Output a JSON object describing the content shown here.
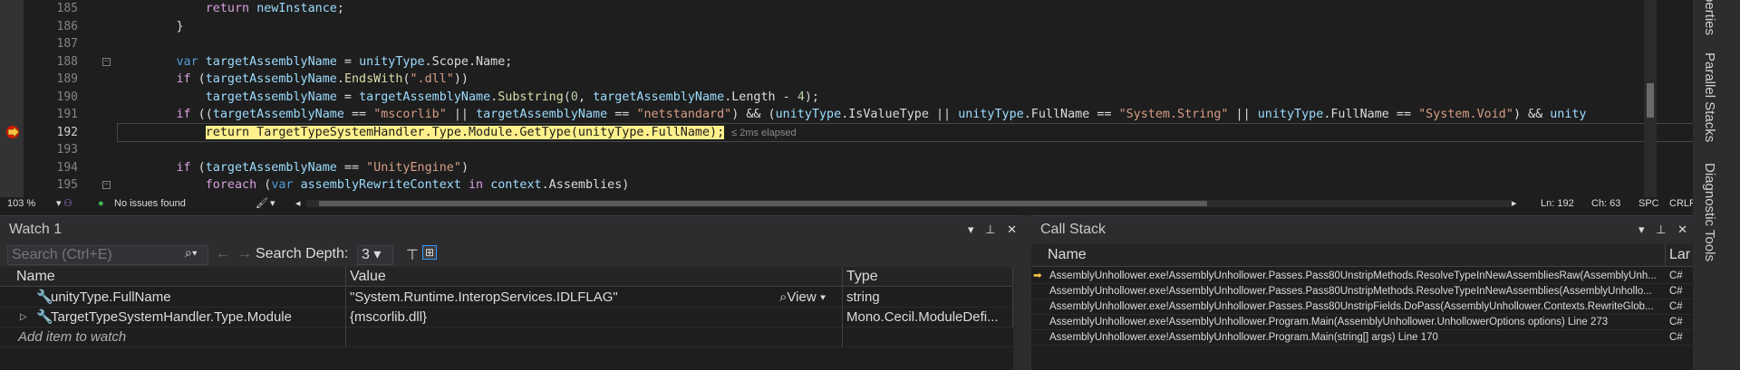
{
  "editor": {
    "lines": [
      {
        "num": "185",
        "indent": "            ",
        "tokens": [
          {
            "t": "return",
            "c": "ctrl"
          },
          {
            "t": " "
          },
          {
            "t": "newInstance",
            "c": "id"
          },
          {
            "t": ";"
          }
        ]
      },
      {
        "num": "186",
        "indent": "        ",
        "tokens": [
          {
            "t": "}"
          }
        ]
      },
      {
        "num": "187",
        "indent": "",
        "tokens": []
      },
      {
        "num": "188",
        "indent": "        ",
        "tokens": [
          {
            "t": "var",
            "c": "kw"
          },
          {
            "t": " "
          },
          {
            "t": "targetAssemblyName",
            "c": "id"
          },
          {
            "t": " = "
          },
          {
            "t": "unityType",
            "c": "id"
          },
          {
            "t": ".Scope.Name;"
          }
        ]
      },
      {
        "num": "189",
        "indent": "        ",
        "tokens": [
          {
            "t": "if",
            "c": "ctrl"
          },
          {
            "t": " ("
          },
          {
            "t": "targetAssemblyName",
            "c": "id"
          },
          {
            "t": "."
          },
          {
            "t": "EndsWith",
            "c": "fn"
          },
          {
            "t": "("
          },
          {
            "t": "\".dll\"",
            "c": "str"
          },
          {
            "t": "))"
          }
        ]
      },
      {
        "num": "190",
        "indent": "            ",
        "tokens": [
          {
            "t": "targetAssemblyName",
            "c": "id"
          },
          {
            "t": " = "
          },
          {
            "t": "targetAssemblyName",
            "c": "id"
          },
          {
            "t": "."
          },
          {
            "t": "Substring",
            "c": "fn"
          },
          {
            "t": "("
          },
          {
            "t": "0",
            "c": "num"
          },
          {
            "t": ", "
          },
          {
            "t": "targetAssemblyName",
            "c": "id"
          },
          {
            "t": ".Length - "
          },
          {
            "t": "4",
            "c": "num"
          },
          {
            "t": ");"
          }
        ]
      },
      {
        "num": "191",
        "indent": "        ",
        "tokens": [
          {
            "t": "if",
            "c": "ctrl"
          },
          {
            "t": " (("
          },
          {
            "t": "targetAssemblyName",
            "c": "id"
          },
          {
            "t": " == "
          },
          {
            "t": "\"mscorlib\"",
            "c": "str"
          },
          {
            "t": " || "
          },
          {
            "t": "targetAssemblyName",
            "c": "id"
          },
          {
            "t": " == "
          },
          {
            "t": "\"netstandard\"",
            "c": "str"
          },
          {
            "t": ") && ("
          },
          {
            "t": "unityType",
            "c": "id"
          },
          {
            "t": ".IsValueType || "
          },
          {
            "t": "unityType",
            "c": "id"
          },
          {
            "t": ".FullName == "
          },
          {
            "t": "\"System.String\"",
            "c": "str"
          },
          {
            "t": " || "
          },
          {
            "t": "unityType",
            "c": "id"
          },
          {
            "t": ".FullName == "
          },
          {
            "t": "\"System.Void\"",
            "c": "str"
          },
          {
            "t": ") && "
          },
          {
            "t": "unity",
            "c": "id"
          }
        ]
      },
      {
        "num": "192",
        "indent": "            ",
        "active": true,
        "tokens": [
          {
            "t": "return TargetTypeSystemHandler.Type.Module.GetType(unityType.FullName);",
            "c": "hl"
          }
        ],
        "elapsed": "≤ 2ms elapsed"
      },
      {
        "num": "193",
        "indent": "",
        "tokens": []
      },
      {
        "num": "194",
        "indent": "        ",
        "tokens": [
          {
            "t": "if",
            "c": "ctrl"
          },
          {
            "t": " ("
          },
          {
            "t": "targetAssemblyName",
            "c": "id"
          },
          {
            "t": " == "
          },
          {
            "t": "\"UnityEngine\"",
            "c": "str"
          },
          {
            "t": ")"
          }
        ]
      },
      {
        "num": "195",
        "indent": "            ",
        "tokens": [
          {
            "t": "foreach",
            "c": "ctrl"
          },
          {
            "t": " ("
          },
          {
            "t": "var",
            "c": "kw"
          },
          {
            "t": " "
          },
          {
            "t": "assemblyRewriteContext",
            "c": "id"
          },
          {
            "t": " "
          },
          {
            "t": "in",
            "c": "ctrl"
          },
          {
            "t": " "
          },
          {
            "t": "context",
            "c": "id"
          },
          {
            "t": ".Assemblies)"
          }
        ]
      }
    ]
  },
  "status": {
    "zoom": "103 %",
    "issues": "No issues found",
    "line": "Ln: 192",
    "col": "Ch: 63",
    "spacing": "SPC",
    "eol": "CRLF"
  },
  "right_rail": {
    "tabs": [
      "perties",
      "Parallel Stacks",
      "Diagnostic Tools"
    ]
  },
  "watch": {
    "title": "Watch 1",
    "search_placeholder": "Search (Ctrl+E)",
    "search_depth_label": "Search Depth:",
    "search_depth_value": "3",
    "columns": [
      "Name",
      "Value",
      "Type"
    ],
    "rows": [
      {
        "name": "unityType.FullName",
        "value": "\"System.Runtime.InteropServices.IDLFLAG\"",
        "view": "View",
        "type": "string",
        "expandable": false
      },
      {
        "name": "TargetTypeSystemHandler.Type.Module",
        "value": "{mscorlib.dll}",
        "view": "",
        "type": "Mono.Cecil.ModuleDefi...",
        "expandable": true
      }
    ],
    "add_item": "Add item to watch"
  },
  "callstack": {
    "title": "Call Stack",
    "columns": [
      "Name",
      "Lar"
    ],
    "rows": [
      {
        "name": "AssemblyUnhollower.exe!AssemblyUnhollower.Passes.Pass80UnstripMethods.ResolveTypeInNewAssembliesRaw(AssemblyUnh...",
        "lang": "C#",
        "current": true
      },
      {
        "name": "AssemblyUnhollower.exe!AssemblyUnhollower.Passes.Pass80UnstripMethods.ResolveTypeInNewAssemblies(AssemblyUnhollo...",
        "lang": "C#",
        "current": false
      },
      {
        "name": "AssemblyUnhollower.exe!AssemblyUnhollower.Passes.Pass80UnstripFields.DoPass(AssemblyUnhollower.Contexts.RewriteGlob...",
        "lang": "C#",
        "current": false
      },
      {
        "name": "AssemblyUnhollower.exe!AssemblyUnhollower.Program.Main(AssemblyUnhollower.UnhollowerOptions options) Line 273",
        "lang": "C#",
        "current": false
      },
      {
        "name": "AssemblyUnhollower.exe!AssemblyUnhollower.Program.Main(string[] args) Line 170",
        "lang": "C#",
        "current": false
      }
    ]
  }
}
